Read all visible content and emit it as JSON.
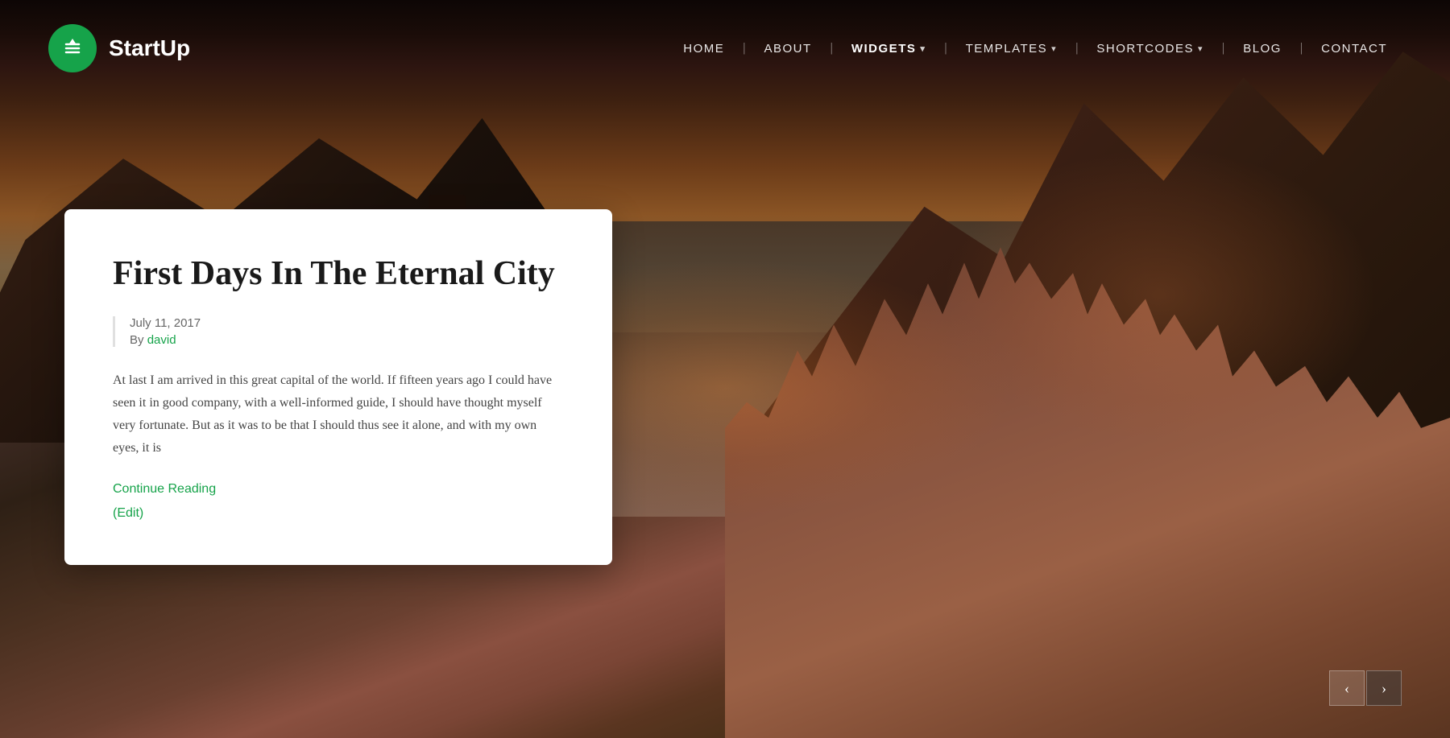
{
  "brand": {
    "logo_text": "StartUp"
  },
  "nav": {
    "items": [
      {
        "label": "HOME",
        "href": "#",
        "active": false,
        "dropdown": false
      },
      {
        "label": "ABOUT",
        "href": "#",
        "active": false,
        "dropdown": false
      },
      {
        "label": "WIDGETS",
        "href": "#",
        "active": true,
        "dropdown": true
      },
      {
        "label": "TEMPLATES",
        "href": "#",
        "active": false,
        "dropdown": true
      },
      {
        "label": "SHORTCODES",
        "href": "#",
        "active": false,
        "dropdown": true
      },
      {
        "label": "BLOG",
        "href": "#",
        "active": false,
        "dropdown": false
      },
      {
        "label": "CONTACT",
        "href": "#",
        "active": false,
        "dropdown": false
      }
    ]
  },
  "blog_card": {
    "title": "First Days In The Eternal City",
    "date": "July 11, 2017",
    "author_prefix": "By ",
    "author": "david",
    "excerpt": "At last I am arrived in this great capital of the world. If fifteen years ago I could have seen it in good company, with a well-informed guide, I should have thought myself very fortunate. But as it was to be that I should thus see it alone, and with my own eyes, it is",
    "continue_reading": "Continue Reading",
    "edit": "(Edit)"
  },
  "slider": {
    "prev_label": "‹",
    "next_label": "›"
  }
}
